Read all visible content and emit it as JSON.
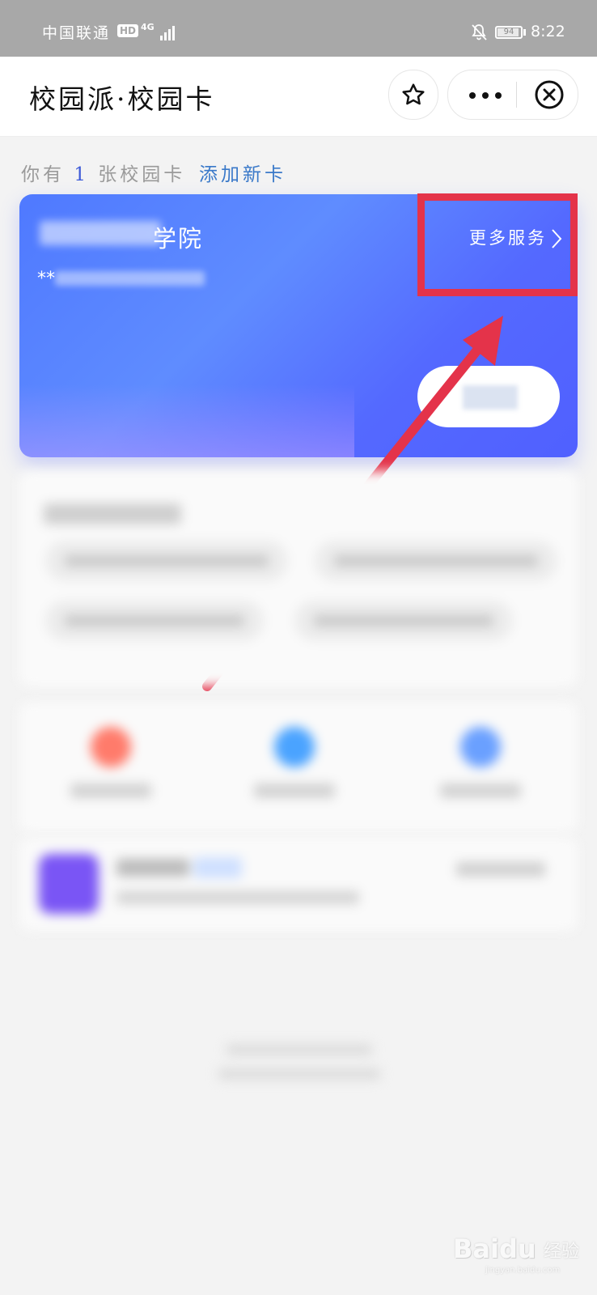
{
  "status_bar": {
    "carrier": "中国联通",
    "hd_badge": "HD",
    "network_type": "4G",
    "battery_level": "94",
    "battery_percent": 94,
    "time": "8:22"
  },
  "nav_bar": {
    "title": "校园派·校园卡",
    "icons": [
      "star-icon",
      "more-icon",
      "close-icon"
    ]
  },
  "card_summary": {
    "prefix": "你有",
    "count": "1",
    "suffix": "张校园卡",
    "add_card_label": "添加新卡"
  },
  "campus_card": {
    "school_name_suffix": "学院",
    "card_number_mask": "**",
    "more_services_label": "更多服务"
  },
  "watermark": {
    "logo": "Baidu",
    "text": "经验",
    "url": "jingyan.baidu.com"
  },
  "colors": {
    "status_bar": "#a8a8a8",
    "card_gradient_start": "#4f79ff",
    "card_gradient_end": "#5060ff",
    "highlight": "#e4334a",
    "add_card_link": "#3a79c9"
  }
}
